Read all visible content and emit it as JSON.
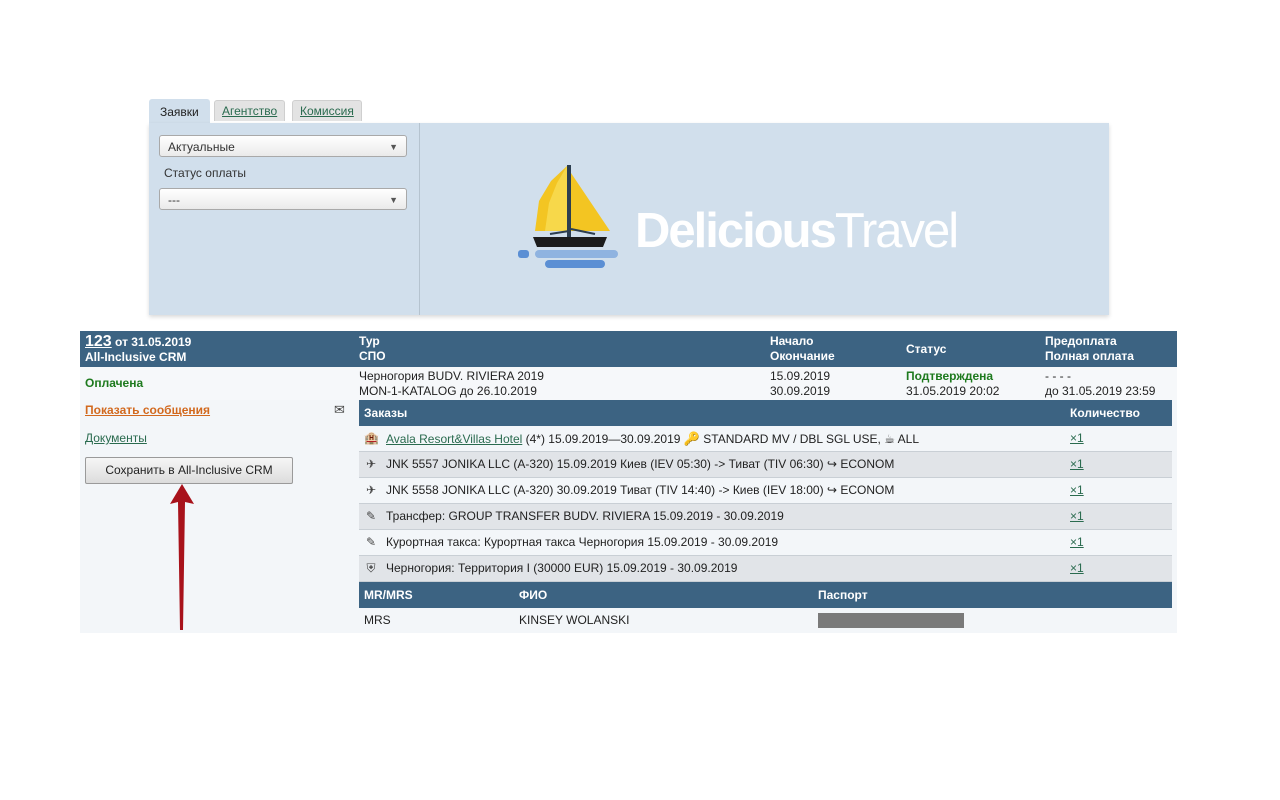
{
  "tabs": [
    {
      "label": "Заявки",
      "active": true
    },
    {
      "label": "Агентство",
      "active": false
    },
    {
      "label": "Комиссия",
      "active": false
    }
  ],
  "filters": {
    "status_select": "Актуальные",
    "payment_label": "Статус оплаты",
    "payment_select": "---"
  },
  "logo": {
    "bold": "Delicious",
    "light": "Travel"
  },
  "order": {
    "number": "123",
    "date": "от 31.05.2019",
    "source": "All-Inclusive CRM",
    "headers": {
      "tour": "Тур",
      "spo": "СПО",
      "start": "Начало",
      "end": "Окончание",
      "status": "Статус",
      "prepay": "Предоплата",
      "fullpay": "Полная оплата"
    },
    "payment_status": "Оплачена",
    "tour": "Черногория BUDV. RIVIERA 2019",
    "spo": "MON-1-KATALOG до 26.10.2019",
    "start": "15.09.2019",
    "end": "30.09.2019",
    "status": "Подтверждена",
    "status_date": "31.05.2019 20:02",
    "prepay": "- - - -",
    "fullpay": "до 31.05.2019 23:59"
  },
  "left": {
    "messages_link": "Показать сообщения",
    "documents_link": "Документы",
    "save_button": "Сохранить в All-Inclusive CRM"
  },
  "orders_table": {
    "col_orders": "Заказы",
    "col_qty": "Количество",
    "rows": [
      {
        "icon": "hotel-icon",
        "hotel_link": "Avala Resort&Villas Hotel",
        "text": " (4*) 15.09.2019—30.09.2019 ",
        "room": "STANDARD MV / DBL SGL USE,",
        "meal": "ALL",
        "qty": "×1"
      },
      {
        "icon": "plane-icon",
        "text": "JNK 5557 JONIKA LLC (A-320) 15.09.2019 Киев (IEV 05:30) -> Тиват (TIV 06:30)",
        "class": "ECONOM",
        "qty": "×1"
      },
      {
        "icon": "plane-icon",
        "text": "JNK 5558 JONIKA LLC (A-320) 30.09.2019 Тиват (TIV 14:40) -> Киев (IEV 18:00)",
        "class": "ECONOM",
        "qty": "×1"
      },
      {
        "icon": "edit-icon",
        "text": "Трансфер: GROUP TRANSFER BUDV. RIVIERA 15.09.2019 - 30.09.2019",
        "qty": "×1"
      },
      {
        "icon": "edit-icon",
        "text": "Курортная такса: Курортная такса Черногория 15.09.2019 - 30.09.2019",
        "qty": "×1"
      },
      {
        "icon": "shield-icon",
        "text": "Черногория: Территория I (30000 EUR) 15.09.2019 - 30.09.2019",
        "qty": "×1"
      }
    ]
  },
  "passengers": {
    "col_title": "MR/MRS",
    "col_name": "ФИО",
    "col_passport": "Паспорт",
    "rows": [
      {
        "title": "MRS",
        "name": "KINSEY WOLANSKI"
      }
    ]
  },
  "colors": {
    "header_bg": "#3c6382",
    "panel_bg": "#d1dfec",
    "status_green": "#1e7a1e",
    "link_orange": "#d2691e",
    "arrow_red": "#a8121b"
  }
}
